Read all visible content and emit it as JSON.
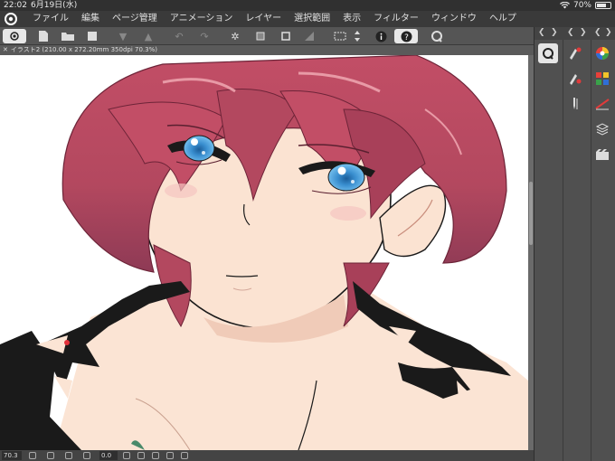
{
  "status": {
    "time": "22:02",
    "date": "6月19日(水)",
    "battery": "70%",
    "battery_level": 0.7
  },
  "menu": {
    "items": [
      "ファイル",
      "編集",
      "ページ管理",
      "アニメーション",
      "レイヤー",
      "選択範囲",
      "表示",
      "フィルター",
      "ウィンドウ",
      "ヘルプ"
    ]
  },
  "document": {
    "tab_title": "イラスト2 (210.00 x 272.20mm 350dpi 70.3%)"
  },
  "bottom": {
    "zoom": "70.3",
    "rotation": "0.0"
  },
  "colors": {
    "hair": "#b8485e",
    "hair_dark": "#8a2f45",
    "hair_light": "#d77a8a",
    "skin": "#fbe3d2",
    "skin_shadow": "#f0c5b2",
    "eye": "#4a9fdb",
    "collar": "#1a1a1a",
    "canvas": "#ffffff"
  },
  "icons": {
    "toolbar": [
      "new-icon",
      "open-icon",
      "save-icon",
      "undo-icon",
      "redo-icon",
      "clear-icon",
      "transform-icon",
      "fit-icon",
      "fill-icon",
      "selection-icon",
      "info-icon",
      "help-icon",
      "search-icon"
    ],
    "panel_right": [
      "color-wheel-icon",
      "color-set-icon",
      "palette-icon",
      "brush-size-icon",
      "layers-icon",
      "animation-icon"
    ],
    "panel_left": [
      "search-icon",
      "sub-tool-icon",
      "tool-property-icon",
      "pen-icon"
    ]
  }
}
